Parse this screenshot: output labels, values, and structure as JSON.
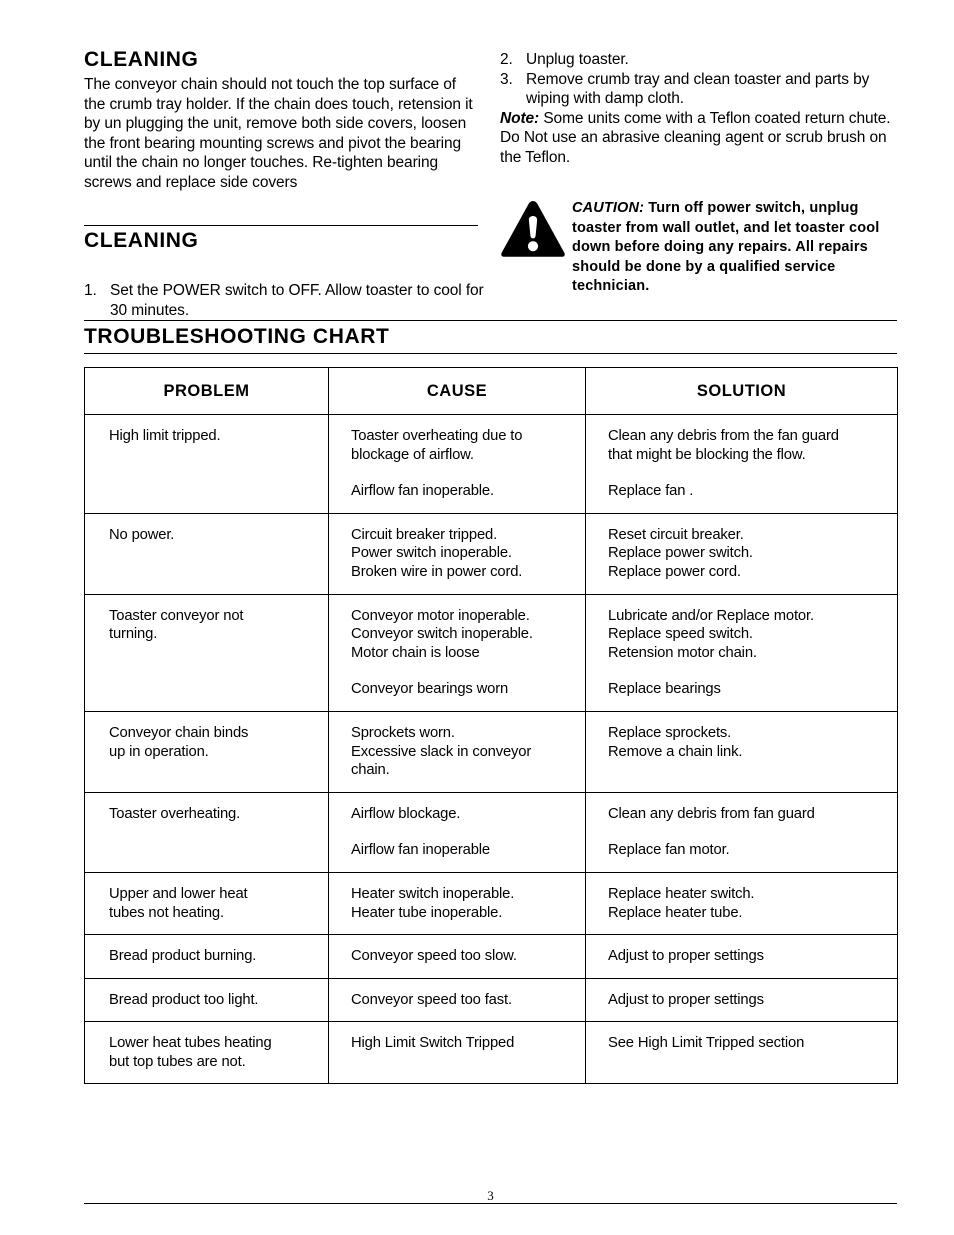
{
  "left_column": {
    "cleaning_heading": "CLEANING",
    "cleaning_paragraph": "The conveyor chain should not touch the top surface of the crumb tray holder. If the chain does touch, retension it by un plugging the unit, remove both side covers, loosen the front bearing mounting screws and pivot the bearing until the chain no longer touches. Re-tighten bearing screws and replace side covers",
    "cleaning_heading_2": "CLEANING",
    "step_1_num": "1.",
    "step_1_text": "Set the POWER switch to OFF. Allow toaster to cool for 30 minutes."
  },
  "right_column": {
    "step_2_num": "2.",
    "step_2_text": "Unplug toaster.",
    "step_3_num": "3.",
    "step_3_text": "Remove crumb tray and clean toaster and parts by wiping with damp cloth.",
    "note_label": "Note:",
    "note_text": " Some units come with a Teflon coated return chute. Do Not use an abrasive cleaning agent or scrub brush on the Teflon."
  },
  "caution": {
    "icon": "warning-triangle-icon",
    "label": "CAUTION:",
    "text": "  Turn off power switch, unplug toaster from wall outlet, and let toaster cool down before doing any repairs.  All repairs should be done by a qualified service technician."
  },
  "troubleshooting": {
    "title": "TROUBLESHOOTING  CHART",
    "columns": [
      "PROBLEM",
      "CAUSE",
      "SOLUTION"
    ],
    "rows": [
      {
        "problem": [
          "High limit tripped."
        ],
        "cause": [
          "Toaster overheating due to\nblockage of airflow.",
          "Airflow fan inoperable."
        ],
        "solution": [
          "Clean any debris from the fan guard\nthat might be blocking the flow.",
          "Replace fan ."
        ]
      },
      {
        "problem": [
          "No power."
        ],
        "cause": [
          "Circuit breaker tripped.\nPower switch inoperable.\nBroken wire in power cord."
        ],
        "solution": [
          "Reset circuit breaker.\nReplace power switch.\nReplace power cord."
        ]
      },
      {
        "problem": [
          "Toaster conveyor not\nturning."
        ],
        "cause": [
          "Conveyor motor inoperable.\nConveyor switch inoperable.\nMotor chain is loose",
          "Conveyor bearings worn"
        ],
        "solution": [
          "Lubricate and/or Replace motor.\nReplace speed switch.\nRetension motor chain.",
          "Replace bearings"
        ]
      },
      {
        "problem": [
          "Conveyor chain binds\nup in operation."
        ],
        "cause": [
          "Sprockets worn.\nExcessive slack in conveyor\nchain."
        ],
        "solution": [
          "Replace sprockets.\nRemove a chain link."
        ]
      },
      {
        "problem": [
          "Toaster overheating."
        ],
        "cause": [
          "Airflow blockage.",
          "Airflow fan inoperable"
        ],
        "solution": [
          "Clean any debris from fan guard",
          "Replace fan motor."
        ]
      },
      {
        "problem": [
          "Upper and lower heat\ntubes not heating."
        ],
        "cause": [
          "Heater switch inoperable.\nHeater tube inoperable."
        ],
        "solution": [
          "Replace heater switch.\nReplace heater tube."
        ]
      },
      {
        "problem": [
          "Bread product burning."
        ],
        "cause": [
          "Conveyor speed too slow."
        ],
        "solution": [
          "Adjust to proper settings"
        ]
      },
      {
        "problem": [
          "Bread product too light."
        ],
        "cause": [
          "Conveyor speed too fast."
        ],
        "solution": [
          "Adjust to proper settings"
        ]
      },
      {
        "problem": [
          "Lower heat tubes heating\nbut top tubes are not."
        ],
        "cause": [
          "High Limit Switch Tripped"
        ],
        "solution": [
          "See High Limit Tripped section"
        ]
      }
    ]
  },
  "footer": {
    "page_number": "3"
  }
}
